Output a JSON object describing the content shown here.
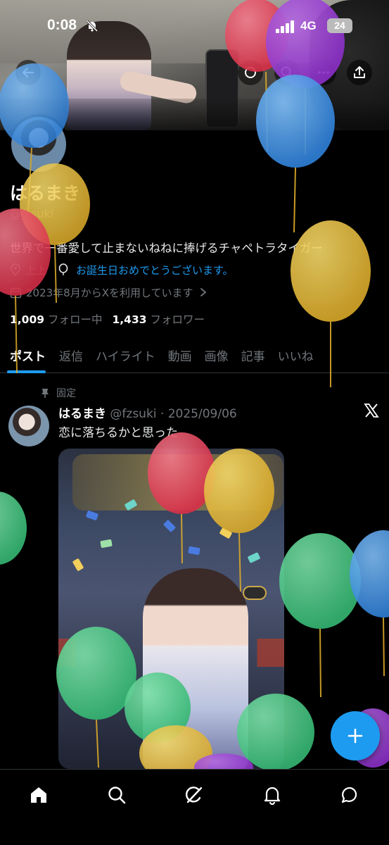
{
  "status_bar": {
    "time": "0:08",
    "network": "4G",
    "battery": "24"
  },
  "profile": {
    "display_name": "はるまき",
    "handle": "@fzsuki",
    "bio": "世界で一番愛して止まないねねに捧げるチャペトラタイガー",
    "location": "上上",
    "birthday_message": "お誕生日おめでとうございます。",
    "joined": "2023年8月からXを利用しています",
    "following_count": "1,009",
    "following_label": "フォロー中",
    "followers_count": "1,433",
    "followers_label": "フォロワー"
  },
  "tabs": [
    "ポスト",
    "返信",
    "ハイライト",
    "動画",
    "画像",
    "記事",
    "いいね"
  ],
  "pinned_post": {
    "pin_label": "固定",
    "author_name": "はるまき",
    "author_meta": "@fzsuki · 2025/09/06",
    "text": "恋に落ちるかと思った"
  },
  "icons": {
    "back": "back-arrow-icon",
    "share": "share-icon",
    "compose": "plus-icon",
    "nav": [
      "home-icon",
      "search-icon",
      "grok-icon",
      "notifications-icon",
      "messages-icon"
    ]
  },
  "colors": {
    "accent": "#1d9bf0",
    "background": "#000000",
    "muted": "#71767b"
  }
}
